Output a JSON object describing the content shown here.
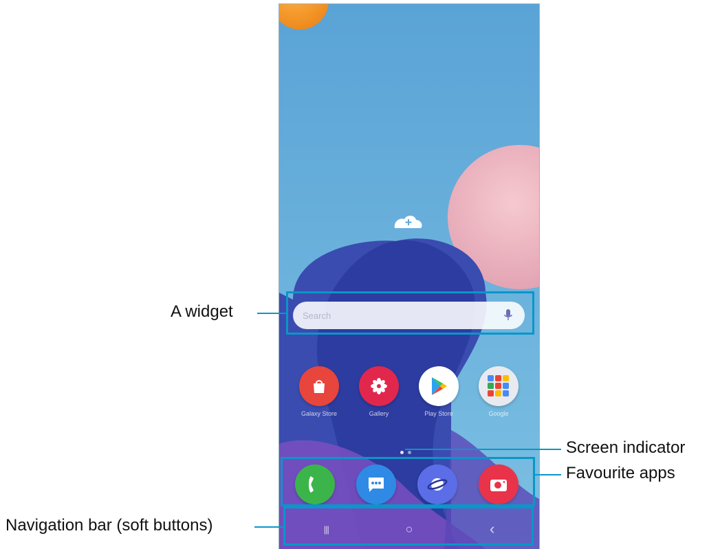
{
  "callouts": {
    "widget": "A widget",
    "screen_indicator": "Screen indicator",
    "favourite_apps": "Favourite apps",
    "navigation_bar": "Navigation bar (soft buttons)"
  },
  "search_widget": {
    "placeholder": "Search",
    "icon": "mic-icon"
  },
  "home_apps": [
    {
      "label": "Galaxy Store",
      "icon": "shopping-bag-icon",
      "color": "#e8453c"
    },
    {
      "label": "Gallery",
      "icon": "flower-icon",
      "color": "#e2274d"
    },
    {
      "label": "Play Store",
      "icon": "play-triangle-icon",
      "color": "#ffffff"
    },
    {
      "label": "Google",
      "icon": "folder-icon",
      "color": "#e8eaf0"
    }
  ],
  "page_indicator": {
    "count": 2,
    "active": 1
  },
  "favourite_apps": [
    {
      "label": "Phone",
      "icon": "phone-icon",
      "color": "#3bb54a"
    },
    {
      "label": "Messages",
      "icon": "chat-bubble-icon",
      "color": "#2f8ae6"
    },
    {
      "label": "Internet",
      "icon": "planet-icon",
      "color": "#5b6ee8"
    },
    {
      "label": "Camera",
      "icon": "camera-icon",
      "color": "#e8334a"
    }
  ],
  "nav_buttons": [
    {
      "name": "recents",
      "glyph": "|||"
    },
    {
      "name": "home",
      "glyph": "○"
    },
    {
      "name": "back",
      "glyph": "‹"
    }
  ],
  "colors": {
    "callout": "#0a96c8",
    "sky": "#5ea7d9"
  }
}
